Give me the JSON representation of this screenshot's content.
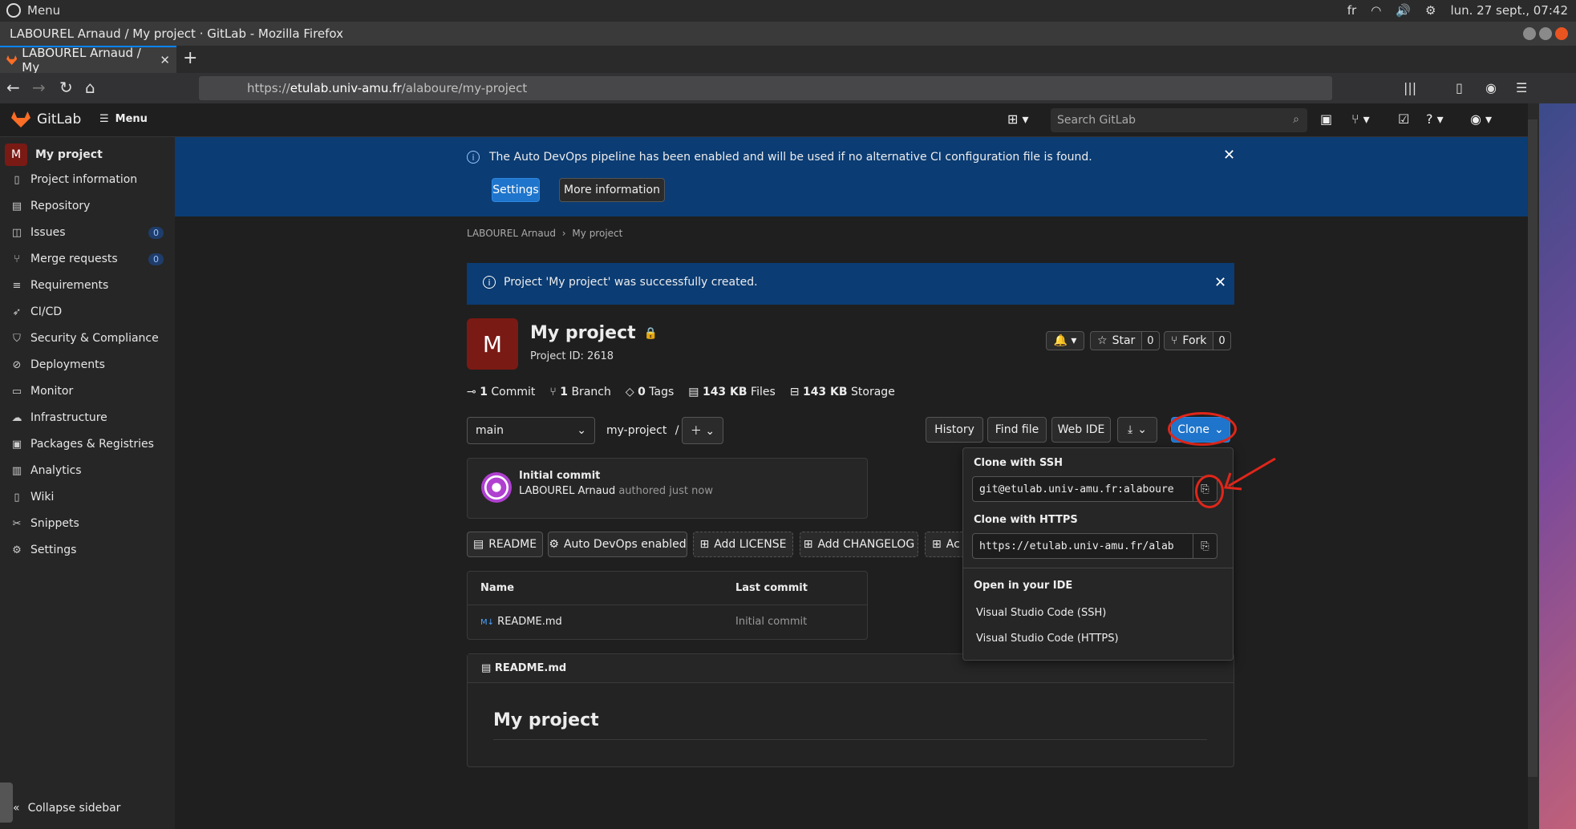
{
  "os": {
    "menu": "Menu",
    "lang": "fr",
    "clock": "lun. 27 sept., 07:42"
  },
  "window": {
    "title": "LABOUREL Arnaud / My project · GitLab - Mozilla Firefox"
  },
  "tab": {
    "label": "LABOUREL Arnaud / My"
  },
  "url": {
    "scheme": "https://",
    "host": "etulab.univ-amu.fr",
    "path": "/alaboure/my-project"
  },
  "gitlab": {
    "brand": "GitLab",
    "menu": "Menu",
    "search_placeholder": "Search GitLab"
  },
  "sidebar": {
    "project": "My project",
    "avatar": "M",
    "items": [
      {
        "label": "Project information",
        "icon": "info-doc-icon"
      },
      {
        "label": "Repository",
        "icon": "repo-icon"
      },
      {
        "label": "Issues",
        "icon": "issues-icon",
        "badge": "0"
      },
      {
        "label": "Merge requests",
        "icon": "merge-icon",
        "badge": "0"
      },
      {
        "label": "Requirements",
        "icon": "requirements-icon"
      },
      {
        "label": "CI/CD",
        "icon": "rocket-icon"
      },
      {
        "label": "Security & Compliance",
        "icon": "shield-icon"
      },
      {
        "label": "Deployments",
        "icon": "deploy-icon"
      },
      {
        "label": "Monitor",
        "icon": "monitor-icon"
      },
      {
        "label": "Infrastructure",
        "icon": "cloud-icon"
      },
      {
        "label": "Packages & Registries",
        "icon": "package-icon"
      },
      {
        "label": "Analytics",
        "icon": "chart-icon"
      },
      {
        "label": "Wiki",
        "icon": "book-icon"
      },
      {
        "label": "Snippets",
        "icon": "scissors-icon"
      },
      {
        "label": "Settings",
        "icon": "gear-icon"
      }
    ],
    "collapse": "Collapse sidebar"
  },
  "banner": {
    "message": "The Auto DevOps pipeline has been enabled and will be used if no alternative CI configuration file is found.",
    "settings": "Settings",
    "more_info": "More information"
  },
  "breadcrumb": {
    "owner": "LABOUREL Arnaud",
    "sep": "›",
    "project": "My project"
  },
  "success_alert": "Project 'My project' was successfully created.",
  "project": {
    "avatar": "M",
    "name": "My project",
    "id_text": "Project ID: 2618",
    "star": "Star",
    "star_count": "0",
    "fork": "Fork",
    "fork_count": "0",
    "stats": {
      "commits_n": "1",
      "commits_label": "Commit",
      "branch_n": "1",
      "branch_label": "Branch",
      "tags_n": "0",
      "tags_label": "Tags",
      "files_n": "143 KB",
      "files_label": "Files",
      "storage_n": "143 KB",
      "storage_label": "Storage"
    }
  },
  "repo_bar": {
    "branch": "main",
    "path": "my-project",
    "path_sep": "/",
    "history": "History",
    "find_file": "Find file",
    "web_ide": "Web IDE",
    "clone": "Clone"
  },
  "commit": {
    "title": "Initial commit",
    "author": "LABOUREL Arnaud",
    "when": "authored just now"
  },
  "tools": {
    "readme": "README",
    "autodevops": "Auto DevOps enabled",
    "license": "Add LICENSE",
    "changelog": "Add CHANGELOG",
    "more": "Ac"
  },
  "table": {
    "col_name": "Name",
    "col_last": "Last commit",
    "row_file": "README.md",
    "row_commit": "Initial commit"
  },
  "readme": {
    "file": "README.md",
    "heading": "My project"
  },
  "clone_dropdown": {
    "ssh_title": "Clone with SSH",
    "ssh_url": "git@etulab.univ-amu.fr:alaboure",
    "https_title": "Clone with HTTPS",
    "https_url": "https://etulab.univ-amu.fr/alab",
    "ide_title": "Open in your IDE",
    "vscode_ssh": "Visual Studio Code (SSH)",
    "vscode_https": "Visual Studio Code (HTTPS)"
  },
  "colors": {
    "brand": "#fc6d26",
    "alert_bg": "#0b3c73",
    "primary": "#1f75cb",
    "annotation": "#e0261a"
  }
}
